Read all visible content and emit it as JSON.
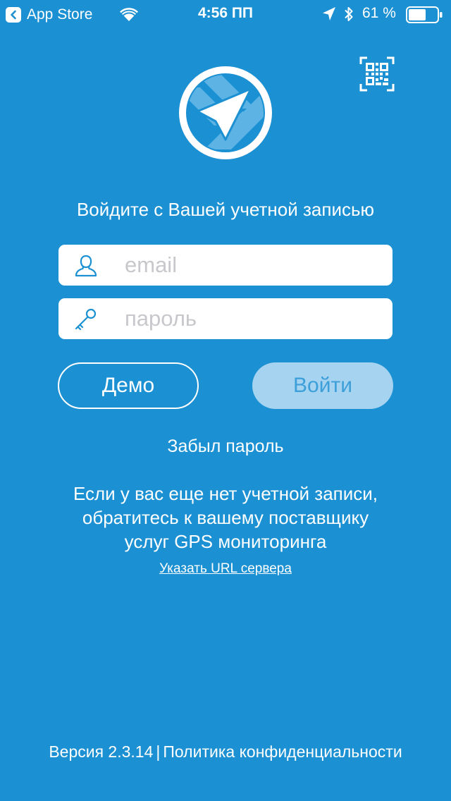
{
  "status_bar": {
    "back_app_label": "App Store",
    "time": "4:56 ПП",
    "battery_percent": "61 %",
    "battery_level": 0.61,
    "icons": [
      "back-chevron-icon",
      "wifi-icon",
      "location-arrow-icon",
      "bluetooth-icon",
      "battery-icon"
    ]
  },
  "header": {
    "qr_icon": "qr-code-scan-icon",
    "logo_icon": "gps-arrow-logo"
  },
  "login": {
    "heading": "Войдите с Вашей учетной записью",
    "email_placeholder": "email",
    "email_value": "",
    "email_icon": "user-icon",
    "password_placeholder": "пароль",
    "password_value": "",
    "password_icon": "key-icon",
    "demo_label": "Демо",
    "login_label": "Войти",
    "forgot_label": "Забыл пароль"
  },
  "info": {
    "lines": [
      "Если у вас еще нет учетной записи,",
      "обратитесь к вашему поставщику",
      "услуг GPS мониторинга"
    ],
    "server_url_label": "Указать URL сервера"
  },
  "footer": {
    "version": "Версия 2.3.14",
    "separator": "|",
    "privacy_label": "Политика конфиденциальности"
  },
  "colors": {
    "background": "#1b90d2",
    "login_button_bg": "#a6d3ef",
    "login_button_text": "#3d9fda",
    "field_bg": "#ffffff",
    "placeholder": "#c8c8cc"
  }
}
